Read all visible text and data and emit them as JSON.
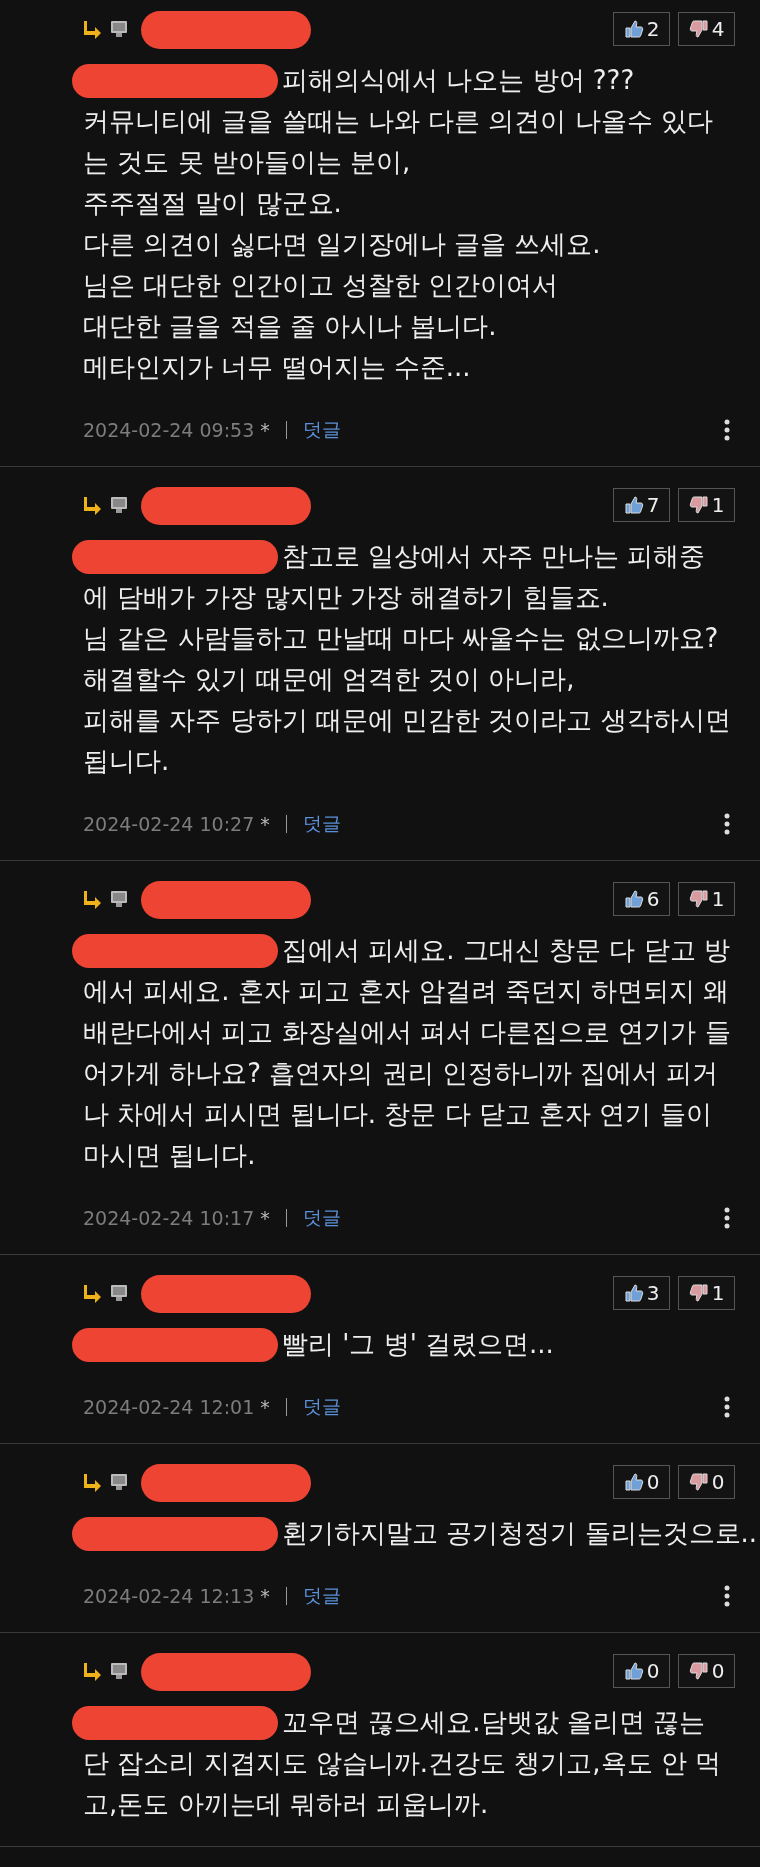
{
  "comments": [
    {
      "likes": "2",
      "dislikes": "4",
      "lines": [
        "피해의식에서 나오는 방어 ???",
        "커뮤니티에 글을 쓸때는 나와 다른 의견이 나올수 있다",
        "는 것도 못 받아들이는 분이,",
        "주주절절 말이 많군요.",
        "다른 의견이 싫다면 일기장에나 글을 쓰세요.",
        "님은 대단한 인간이고 성찰한 인간이여서",
        "대단한 글을 적을 줄 아시나 봅니다.",
        "메타인지가 너무 떨어지는 수준..."
      ],
      "footer": {
        "date": "2024-02-24 09:53",
        "mark": "*",
        "reply": "덧글"
      }
    },
    {
      "likes": "7",
      "dislikes": "1",
      "lines": [
        "참고로 일상에서 자주 만나는 피해중",
        "에 담배가 가장 많지만 가장 해결하기 힘들죠.",
        "님 같은 사람들하고 만날때 마다 싸울수는 없으니까요?",
        "해결할수 있기 때문에 엄격한 것이 아니라,",
        "피해를 자주 당하기 때문에 민감한 것이라고 생각하시면",
        "됩니다."
      ],
      "footer": {
        "date": "2024-02-24 10:27",
        "mark": "*",
        "reply": "덧글"
      }
    },
    {
      "likes": "6",
      "dislikes": "1",
      "lines": [
        "집에서 피세요. 그대신 창문 다 닫고 방",
        "에서 피세요. 혼자 피고 혼자 암걸려 죽던지 하면되지 왜",
        "배란다에서 피고 화장실에서 펴서 다른집으로 연기가 들",
        "어가게 하나요? 흡연자의 권리 인정하니까 집에서 피거",
        "나 차에서 피시면 됩니다. 창문 다 닫고 혼자 연기 들이",
        "마시면 됩니다."
      ],
      "footer": {
        "date": "2024-02-24 10:17",
        "mark": "*",
        "reply": "덧글"
      }
    },
    {
      "likes": "3",
      "dislikes": "1",
      "lines": [
        "빨리 '그 병' 걸렸으면..."
      ],
      "footer": {
        "date": "2024-02-24 12:01",
        "mark": "*",
        "reply": "덧글"
      }
    },
    {
      "likes": "0",
      "dislikes": "0",
      "lines": [
        "횐기하지말고 공기청정기 돌리는것으로.."
      ],
      "footer": {
        "date": "2024-02-24 12:13",
        "mark": "*",
        "reply": "덧글"
      }
    },
    {
      "likes": "0",
      "dislikes": "0",
      "lines": [
        "꼬우면 끊으세요.담뱃값 올리면 끊는",
        "단 잡소리 지겹지도 않습니까.건강도 챙기고,욕도 안 먹",
        "고,돈도 아끼는데 뭐하러 피웁니까."
      ]
    }
  ]
}
